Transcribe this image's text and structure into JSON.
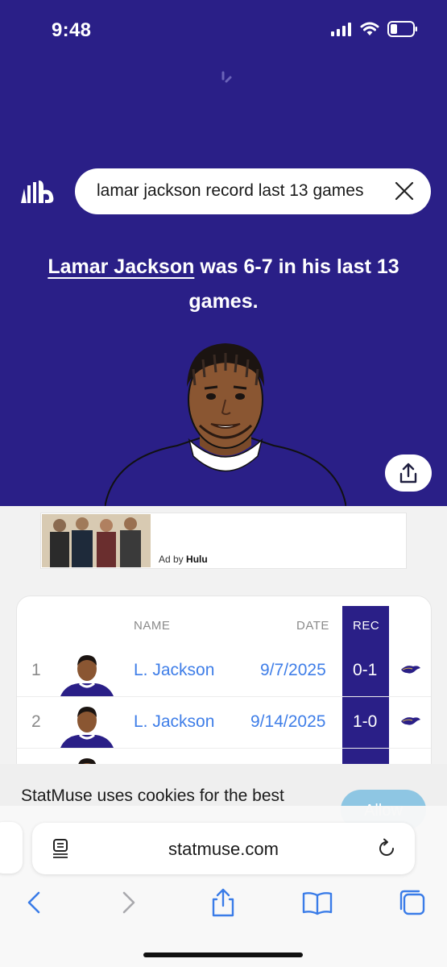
{
  "status_bar": {
    "time": "9:48"
  },
  "search": {
    "query": "lamar jackson record last 13 games"
  },
  "answer": {
    "player_link": "Lamar Jackson",
    "text": " was 6-7 in his last 13 games."
  },
  "ad": {
    "prefix": "Ad by",
    "brand": "Hulu"
  },
  "table": {
    "headers": {
      "name": "NAME",
      "date": "DATE",
      "rec": "REC"
    },
    "rows": [
      {
        "rank": "1",
        "name": "L. Jackson",
        "date": "9/7/2025",
        "rec": "0-1"
      },
      {
        "rank": "2",
        "name": "L. Jackson",
        "date": "9/14/2025",
        "rec": "1-0"
      }
    ]
  },
  "cookie": {
    "text": "StatMuse uses cookies for the best",
    "button": "Allow"
  },
  "browser": {
    "url": "statmuse.com"
  },
  "icons": [
    "signal-icon",
    "wifi-icon",
    "battery-icon",
    "statmuse-logo-icon",
    "close-icon",
    "share-icon",
    "reader-icon",
    "reload-icon",
    "back-icon",
    "forward-icon",
    "share-sheet-icon",
    "bookmarks-icon",
    "tabs-icon",
    "ravens-logo-icon"
  ],
  "colors": {
    "brand": "#2a1f87",
    "link": "#3f7ee8",
    "allow": "#8ec6e3"
  }
}
